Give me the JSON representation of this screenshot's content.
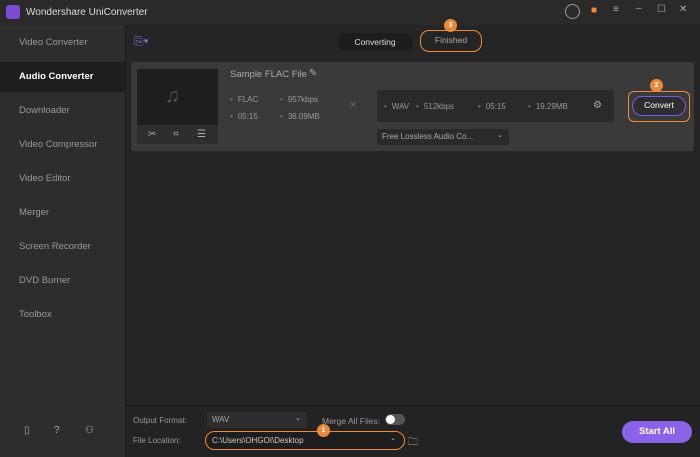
{
  "app": {
    "title": "Wondershare UniConverter",
    "brand_color": "#7b4bd6",
    "accent": "#f08a36"
  },
  "sidebar": {
    "items": [
      {
        "label": "Video Converter"
      },
      {
        "label": "Audio Converter",
        "active": true
      },
      {
        "label": "Downloader"
      },
      {
        "label": "Video Compressor"
      },
      {
        "label": "Video Editor"
      },
      {
        "label": "Merger"
      },
      {
        "label": "Screen Recorder"
      },
      {
        "label": "DVD Burner"
      },
      {
        "label": "Toolbox"
      }
    ]
  },
  "tabs": {
    "converting": "Converting",
    "finished": "Finished"
  },
  "badges": {
    "one": "1",
    "two": "2",
    "three": "3"
  },
  "file": {
    "name": "Sample FLAC File",
    "source": {
      "format": "FLAC",
      "bitrate": "957kbps",
      "duration": "05:15",
      "size": "36.09MB"
    },
    "target": {
      "format": "WAV",
      "bitrate": "512kbps",
      "duration": "05:15",
      "size": "19.29MB"
    },
    "preset": "Free Lossless Audio Co...",
    "convert_label": "Convert"
  },
  "footer": {
    "output_format_label": "Output Format:",
    "output_format": "WAV",
    "merge_label": "Merge All Files:",
    "merge_on": false,
    "file_location_label": "File Location:",
    "file_location": "C:\\Users\\OHGOI\\Desktop",
    "start_all": "Start All"
  }
}
